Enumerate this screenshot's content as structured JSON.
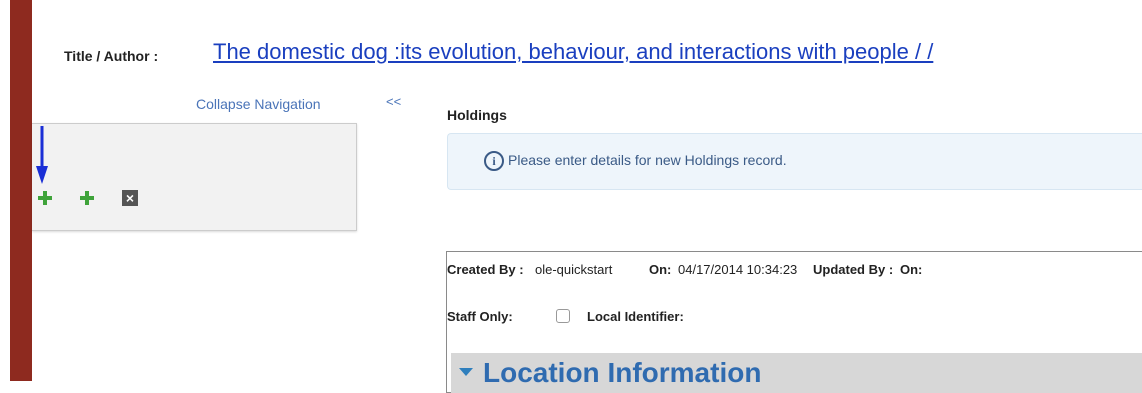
{
  "header": {
    "title_label": "Title / Author :",
    "title_link": "The domestic dog :its evolution, behaviour, and interactions with people / /"
  },
  "navigation": {
    "collapse_label": "Collapse Navigation",
    "collapse_arrows": "<<",
    "icons": [
      "arrow-down-icon",
      "add-icon",
      "add-icon",
      "close-icon"
    ]
  },
  "holdings": {
    "heading": "Holdings",
    "info_message": "Please enter details for new Holdings record.",
    "info_glyph": "i"
  },
  "record": {
    "created_by_label": "Created By :",
    "created_by_value": "ole-quickstart",
    "on_label": "On:",
    "on_value": "04/17/2014 10:34:23",
    "updated_by_label": "Updated By :",
    "updated_on_label": "On:",
    "staff_only_label": "Staff Only:",
    "local_identifier_label": "Local Identifier:",
    "section_title": "Location Information"
  },
  "colors": {
    "left_bar": "#8e2a1f",
    "link": "#1a3fbf",
    "info_bg": "#eef5fb",
    "section_title": "#2f6bb0",
    "add_green": "#3fa33a",
    "arrow_blue": "#1a2fd6"
  }
}
